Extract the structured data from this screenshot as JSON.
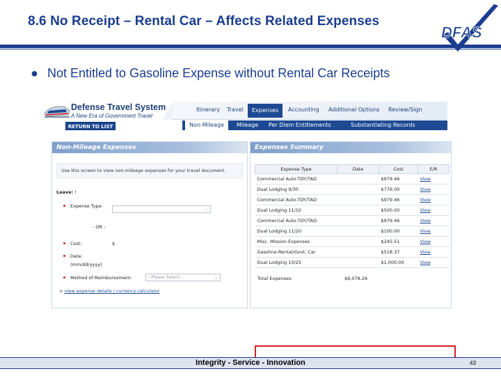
{
  "slide": {
    "title": "8.6 No Receipt – Rental Car – Affects Related Expenses",
    "logo_text": "DFAS",
    "bullet": "Not Entitled to Gasoline Expense without Rental Car Receipts",
    "footer": "Integrity - Service - Innovation",
    "page_number": "43"
  },
  "app": {
    "name": "Defense Travel System",
    "tagline": "A New Era of Government Travel",
    "return_button": "RETURN TO LIST",
    "top_nav": [
      "Itinerary",
      "Travel",
      "Expenses",
      "Accounting",
      "Additional Options",
      "Review/Sign"
    ],
    "top_nav_active": "Expenses",
    "sub_nav": [
      "Non-Mileage",
      "Mileage",
      "Per Diem Entitlements",
      "Substantiating Records"
    ],
    "sub_nav_active": "Non-Mileage"
  },
  "non_mileage": {
    "header": "Non-Mileage Expenses",
    "info": "Use this screen to view non-mileage expenses for your travel document.",
    "leave_label": "Leave:",
    "leave_value": "!",
    "expense_type_label": "Expense Type:",
    "or_label": "- OR -",
    "cost_label": "Cost:",
    "cost_prefix": "$",
    "date_label": "Date:",
    "date_format": "(mm/dd/yyyy)",
    "method_label": "Method of Reimbursement:",
    "method_placeholder": "--Please Select--",
    "details_link": "view expense details / currency calculator",
    "details_marker": ">"
  },
  "summary": {
    "header": "Expenses Summary",
    "columns": [
      "Expense Type",
      "Date",
      "Cost",
      "E/R"
    ],
    "rows": [
      {
        "type": "Commercial Auto-TDY/TAD",
        "date": "",
        "cost": "$979.46",
        "action": "View"
      },
      {
        "type": "Dual Lodging 9/30",
        "date": "",
        "cost": "$776.00",
        "action": "View"
      },
      {
        "type": "Commercial Auto-TDY/TAD",
        "date": "",
        "cost": "$979.46",
        "action": "View"
      },
      {
        "type": "Dual Lodging 11/10",
        "date": "",
        "cost": "$500.00",
        "action": "View"
      },
      {
        "type": "Commercial Auto-TDY/TAD",
        "date": "",
        "cost": "$979.46",
        "action": "View"
      },
      {
        "type": "Dual Lodging 11/20",
        "date": "",
        "cost": "$100.00",
        "action": "View"
      },
      {
        "type": "Misc. Mission Expenses",
        "date": "",
        "cost": "$245.51",
        "action": "View"
      },
      {
        "type": "Gasoline-Rental/Govt. Car",
        "date": "",
        "cost": "$518.37",
        "action": "View"
      },
      {
        "type": "Dual Lodging 10/25",
        "date": "",
        "cost": "$1,000.00",
        "action": "View"
      }
    ],
    "highlighted_row": 7,
    "total_label": "Total Expenses:",
    "total_value": "$6,078.26"
  },
  "colors": {
    "title_blue": "#1a3d8f",
    "dts_blue": "#1e4a94",
    "highlight_red": "#d42020"
  }
}
